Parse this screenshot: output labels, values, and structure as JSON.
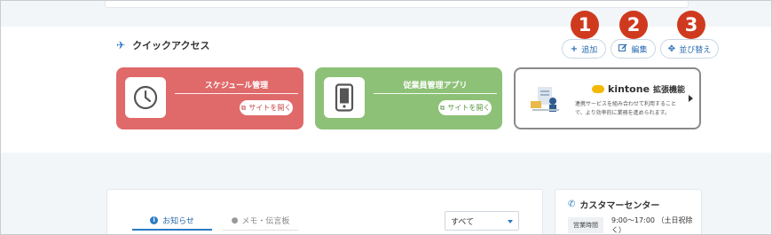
{
  "quick_access": {
    "title": "クイックアクセス",
    "add_label": "追加",
    "edit_label": "編集",
    "sort_label": "並び替え",
    "markers": [
      "1",
      "2",
      "3"
    ]
  },
  "cards": [
    {
      "title": "スケジュール管理",
      "button": "サイトを開く",
      "icon": "clock-icon",
      "color": "#e0696a"
    },
    {
      "title": "従業員管理アプリ",
      "button": "サイトを開く",
      "icon": "smartphone-icon",
      "color": "#8dc177"
    }
  ],
  "kintone": {
    "logo_text": "kintone",
    "suffix": "拡張機能",
    "description": "連携サービスを組み合わせて利用することで、より効率的に業務を進められます。"
  },
  "news": {
    "tab_news": "お知らせ",
    "tab_memo": "メモ・伝言板",
    "filter_value": "すべて"
  },
  "customer_center": {
    "title": "カスタマーセンター",
    "hours_label": "営業時間",
    "hours_value": "9:00～17:00 （土日祝除く）"
  }
}
